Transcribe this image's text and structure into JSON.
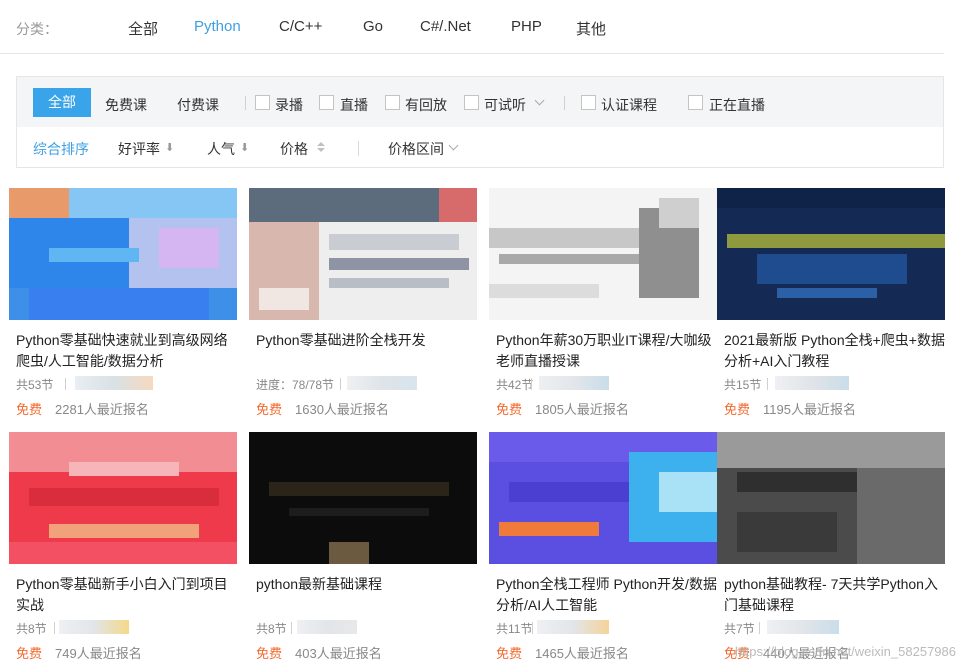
{
  "categories": {
    "label": "分类：",
    "items": [
      "全部",
      "Python",
      "C/C++",
      "Go",
      "C#/.Net",
      "PHP",
      "其他"
    ],
    "active": "Python"
  },
  "filters": {
    "all": "全部",
    "free": "免费课",
    "paid": "付费课",
    "checkboxes": [
      "录播",
      "直播",
      "有回放",
      "可试听",
      "认证课程",
      "正在直播"
    ]
  },
  "sort": {
    "comprehensive": "综合排序",
    "rating": "好评率",
    "popularity": "人气",
    "price": "价格",
    "price_range": "价格区间",
    "down_arrow": "⬇"
  },
  "courses": [
    {
      "title": "Python零基础快速就业到高级网络爬虫/人工智能/数据分析",
      "meta": "共53节",
      "price": "免费",
      "enroll": "2281人最近报名"
    },
    {
      "title": "Python零基础进阶全栈开发",
      "meta": "进度：78/78节",
      "price": "免费",
      "enroll": "1630人最近报名"
    },
    {
      "title": "Python年薪30万职业IT课程/大咖级老师直播授课",
      "meta": "共42节",
      "price": "免费",
      "enroll": "1805人最近报名"
    },
    {
      "title": "2021最新版     Python全栈+爬虫+数据分析+AI入门教程",
      "meta": "共15节",
      "price": "免费",
      "enroll": "1195人最近报名"
    },
    {
      "title": "Python零基础新手小白入门到项目实战",
      "meta": "共8节",
      "price": "免费",
      "enroll": "749人最近报名"
    },
    {
      "title": "python最新基础课程",
      "meta": "共8节",
      "price": "免费",
      "enroll": "403人最近报名"
    },
    {
      "title": "Python全栈工程师 Python开发/数据分析/AI人工智能",
      "meta": "共11节",
      "price": "免费",
      "enroll": "1465人最近报名"
    },
    {
      "title": "python基础教程-   7天共学Python入门基础课程",
      "meta": "共7节",
      "price": "免费",
      "enroll": "440人最近报名"
    }
  ],
  "watermark": "https://blog.csdn.net/weixin_58257986",
  "colors": {
    "accent": "#39a4ea",
    "free": "#f26a2f"
  }
}
